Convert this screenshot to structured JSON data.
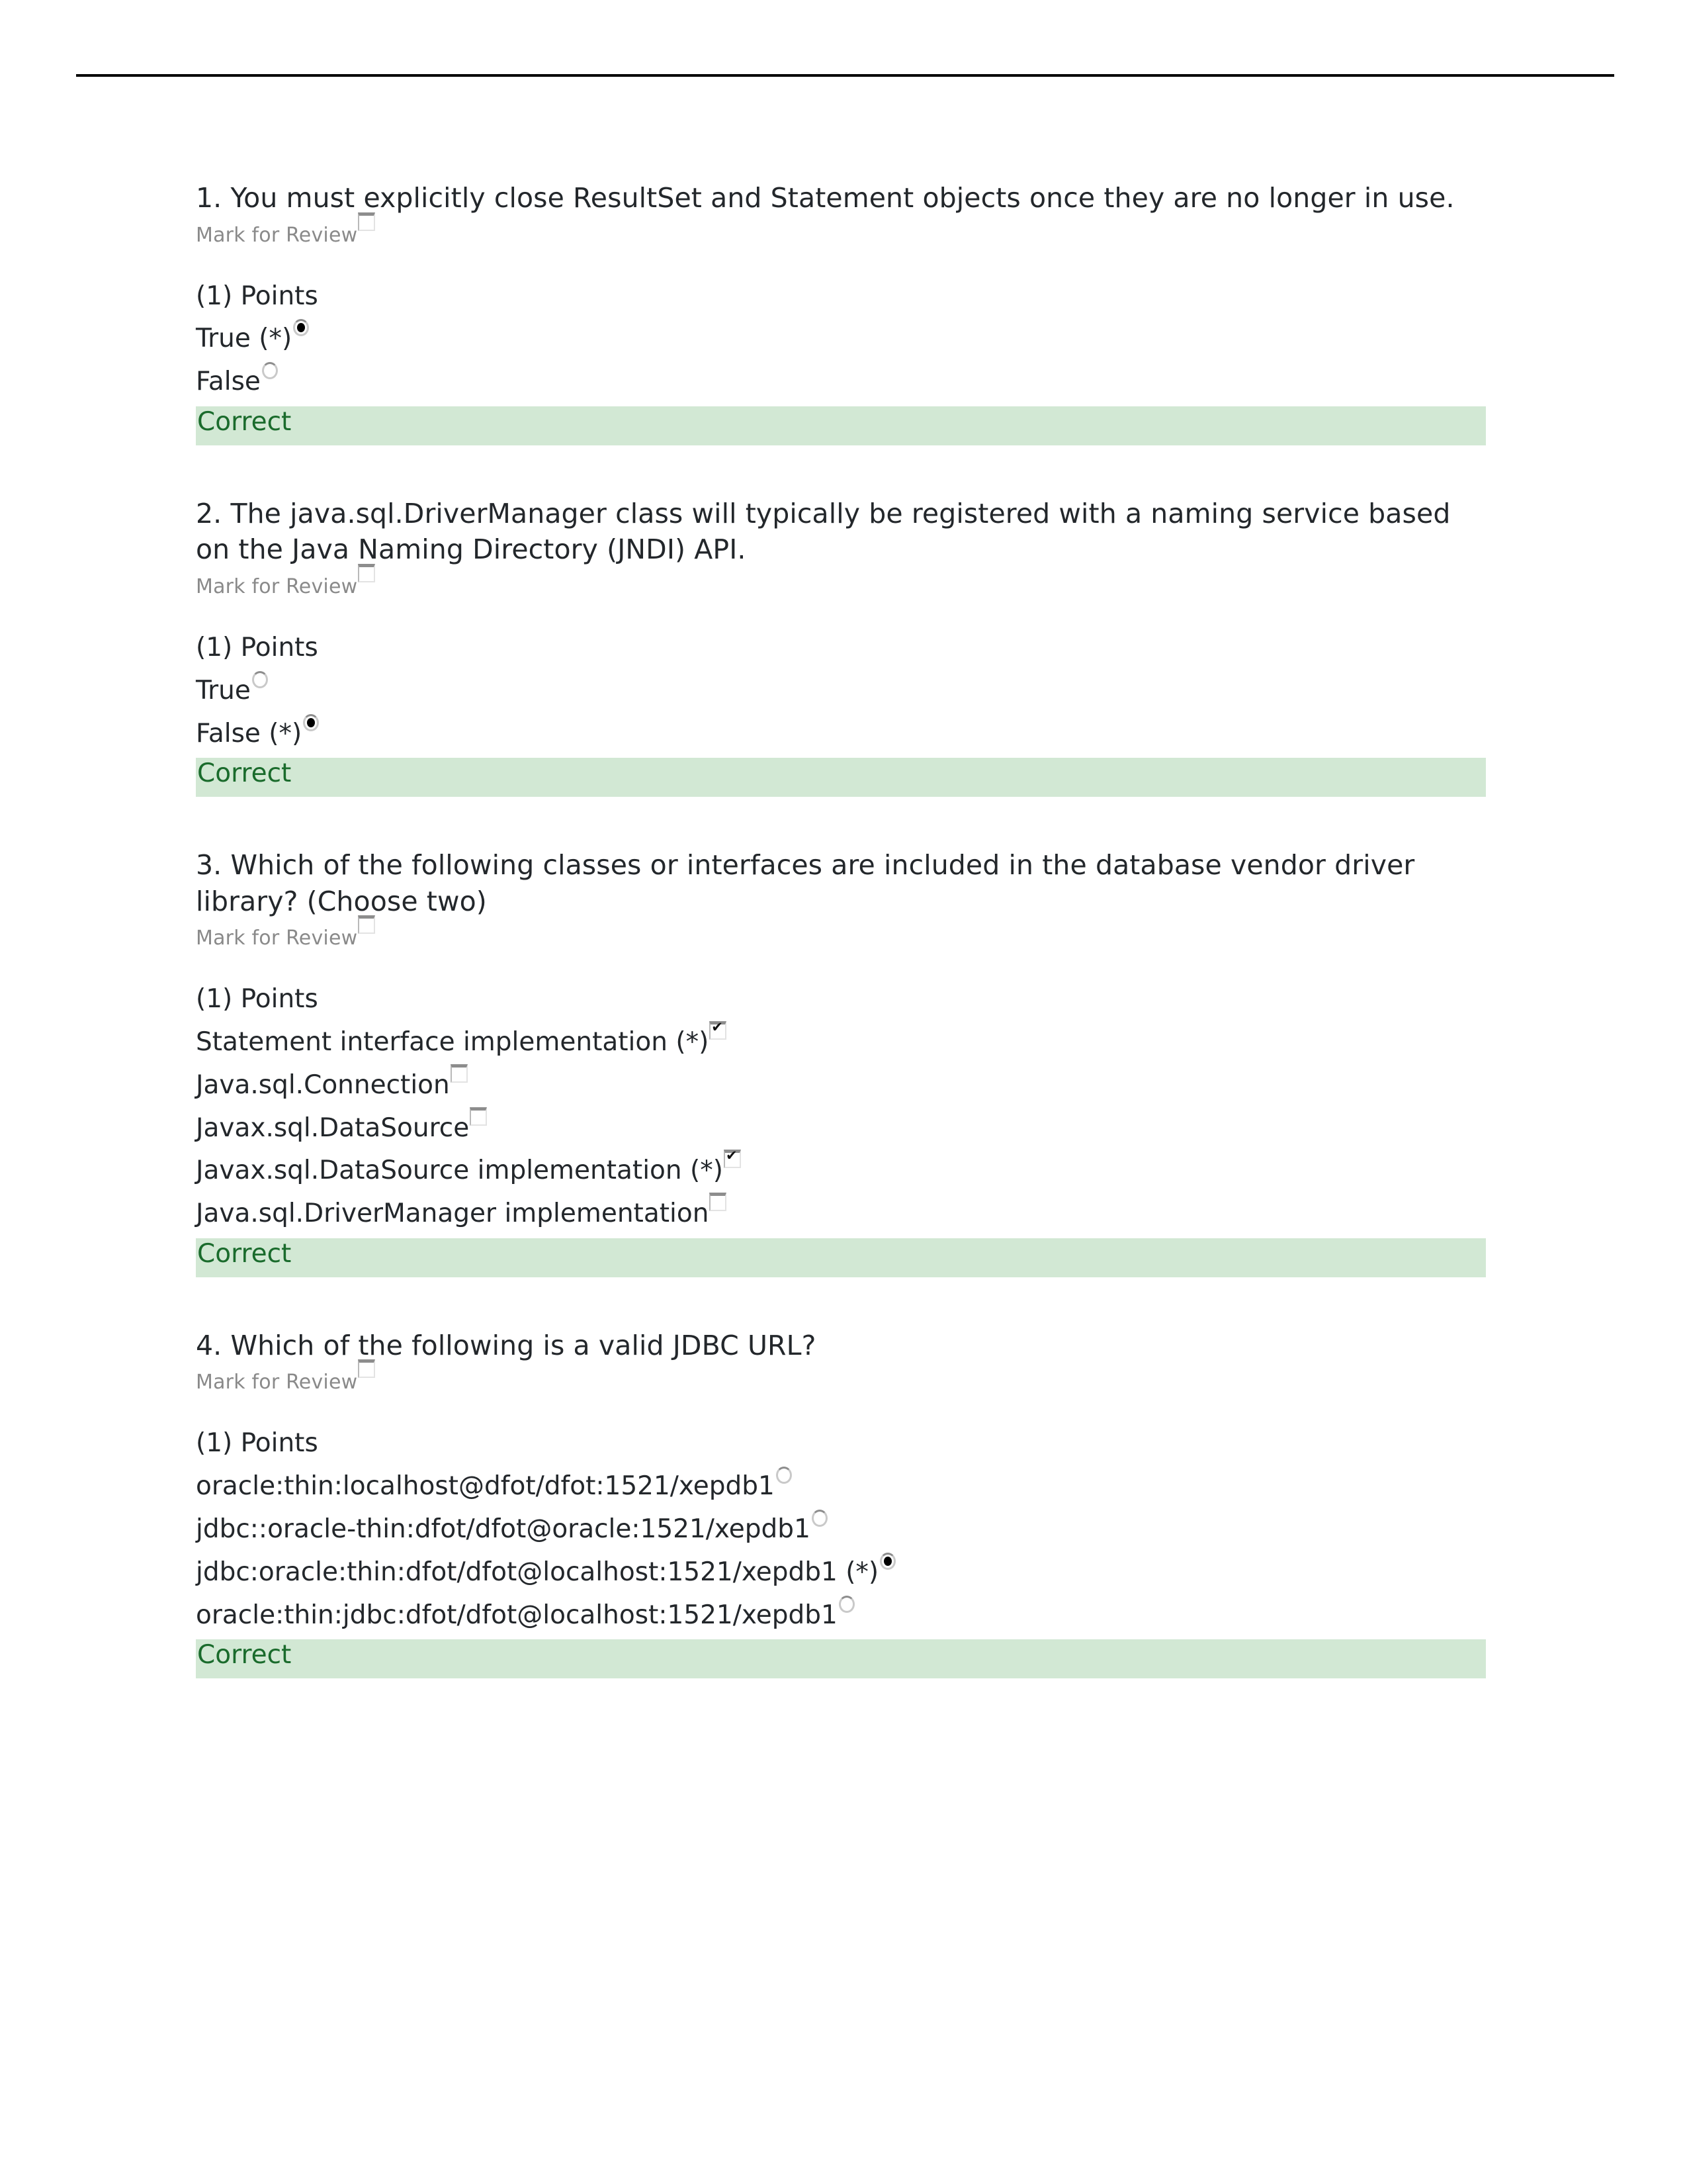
{
  "document": {
    "mark_for_review_label": "Mark for Review",
    "points_label": "(1) Points",
    "correct_label": "Correct",
    "colors": {
      "correct_background": "#d2e8d4",
      "correct_text": "#1a6b2c",
      "body_text": "#23272b",
      "muted_text": "#8a8a8a",
      "rule": "#000000"
    }
  },
  "questions": [
    {
      "number": "1",
      "text": "1. You must explicitly close ResultSet and Statement objects once they are no longer in use.",
      "mark_for_review": "Mark for Review",
      "mark_checked": false,
      "points": "(1) Points",
      "input_type": "radio",
      "options": [
        {
          "label": "True (*)",
          "selected": true
        },
        {
          "label": "False",
          "selected": false
        }
      ],
      "result": "Correct"
    },
    {
      "number": "2",
      "text": "2. The java.sql.DriverManager class will typically be registered with a naming service based on the Java Naming Directory (JNDI) API.",
      "mark_for_review": "Mark for Review",
      "mark_checked": false,
      "points": "(1) Points",
      "input_type": "radio",
      "options": [
        {
          "label": "True",
          "selected": false
        },
        {
          "label": "False (*)",
          "selected": true
        }
      ],
      "result": "Correct"
    },
    {
      "number": "3",
      "text": "3. Which of the following classes or interfaces are included in the database vendor driver library? (Choose two)",
      "mark_for_review": "Mark for Review",
      "mark_checked": false,
      "points": "(1) Points",
      "input_type": "checkbox",
      "options": [
        {
          "label": "Statement interface implementation (*)",
          "selected": true
        },
        {
          "label": "Java.sql.Connection",
          "selected": false
        },
        {
          "label": "Javax.sql.DataSource",
          "selected": false
        },
        {
          "label": "Javax.sql.DataSource implementation (*)",
          "selected": true
        },
        {
          "label": "Java.sql.DriverManager implementation",
          "selected": false
        }
      ],
      "result": "Correct"
    },
    {
      "number": "4",
      "text": "4. Which of the following is a valid JDBC URL?",
      "mark_for_review": "Mark for Review",
      "mark_checked": false,
      "points": "(1) Points",
      "input_type": "radio",
      "options": [
        {
          "label": "oracle:thin:localhost@dfot/dfot:1521/xepdb1",
          "selected": false
        },
        {
          "label": "jdbc::oracle-thin:dfot/dfot@oracle:1521/xepdb1",
          "selected": false
        },
        {
          "label": "jdbc:oracle:thin:dfot/dfot@localhost:1521/xepdb1 (*)",
          "selected": true
        },
        {
          "label": "oracle:thin:jdbc:dfot/dfot@localhost:1521/xepdb1",
          "selected": false
        }
      ],
      "result": "Correct"
    }
  ]
}
